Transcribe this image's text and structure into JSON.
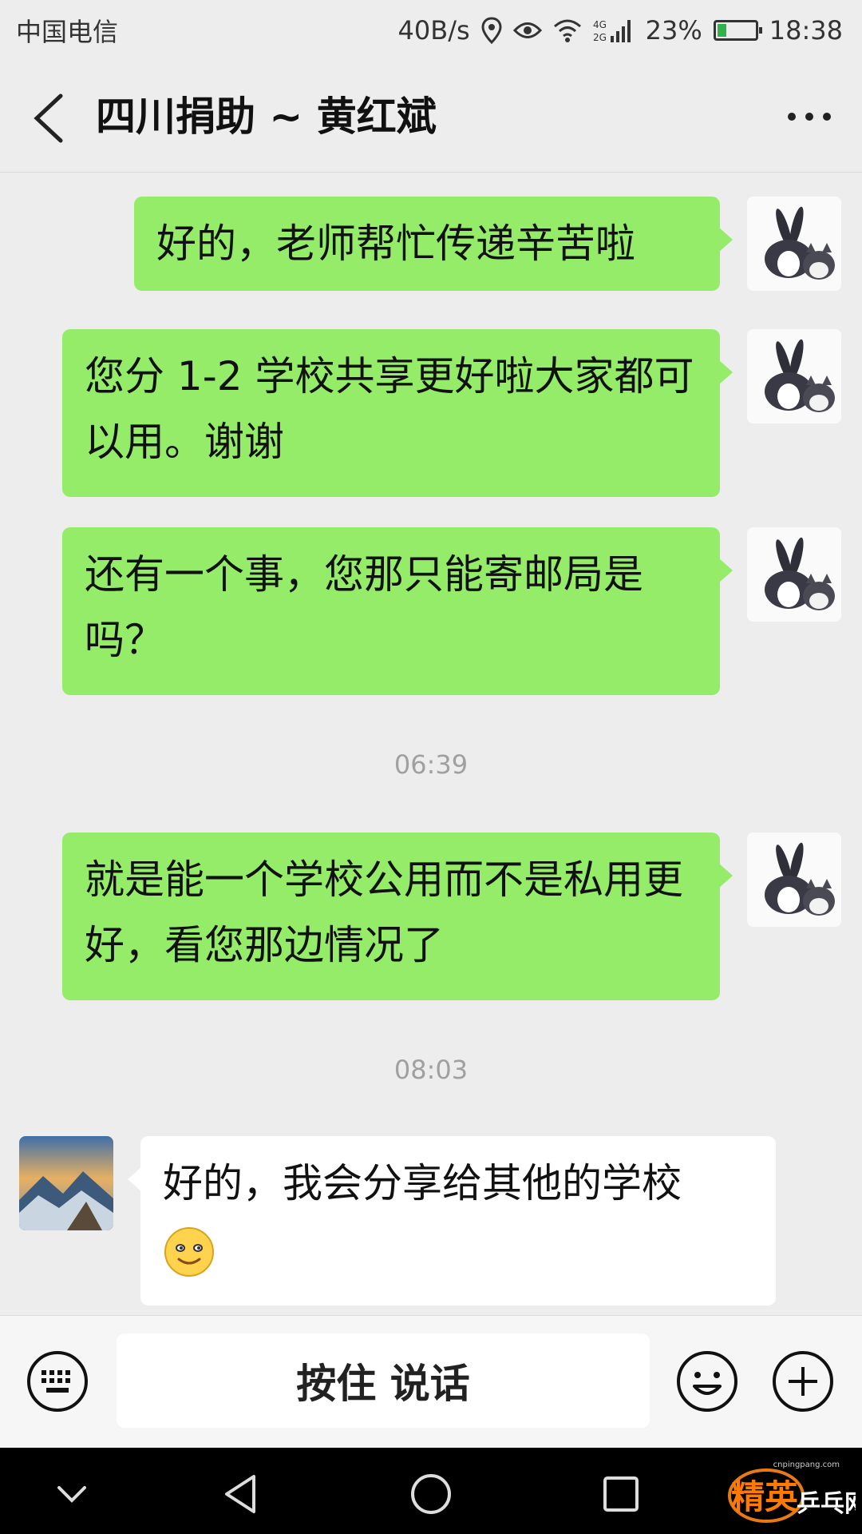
{
  "status_bar": {
    "carrier": "中国电信",
    "net_speed": "40B/s",
    "signal_label": "4G 2G",
    "battery": "23%",
    "battery_level": 0.23,
    "time": "18:38"
  },
  "header": {
    "title": "四川捐助 ~ 黄红斌",
    "back_icon": "chevron-left-icon",
    "more_icon": "more-dots-icon"
  },
  "messages": [
    {
      "from": "me",
      "text": "好的，老师帮忙传递辛苦啦"
    },
    {
      "from": "me",
      "text": "您分 1-2 学校共享更好啦大家都可以用。谢谢"
    },
    {
      "from": "me",
      "text": "还有一个事，您那只能寄邮局是吗？"
    },
    {
      "type": "time",
      "text": "06:39"
    },
    {
      "from": "me",
      "text": "就是能一个学校公用而不是私用更好，看您那边情况了"
    },
    {
      "type": "time",
      "text": "08:03"
    },
    {
      "from": "them",
      "text": "好的，我会分享给其他的学校",
      "emoji": "smile-emoji-icon"
    }
  ],
  "input_bar": {
    "hold_to_talk": "按住 说话",
    "keyboard_icon": "keyboard-icon",
    "emoji_icon": "emoji-icon",
    "plus_icon": "plus-icon"
  },
  "watermark": {
    "text_main": "精英",
    "text_sub": "乒乓网",
    "text_url": "cnpingpang.com"
  },
  "colors": {
    "my_bubble": "#95ec69",
    "their_bubble": "#ffffff",
    "background": "#ededed"
  }
}
